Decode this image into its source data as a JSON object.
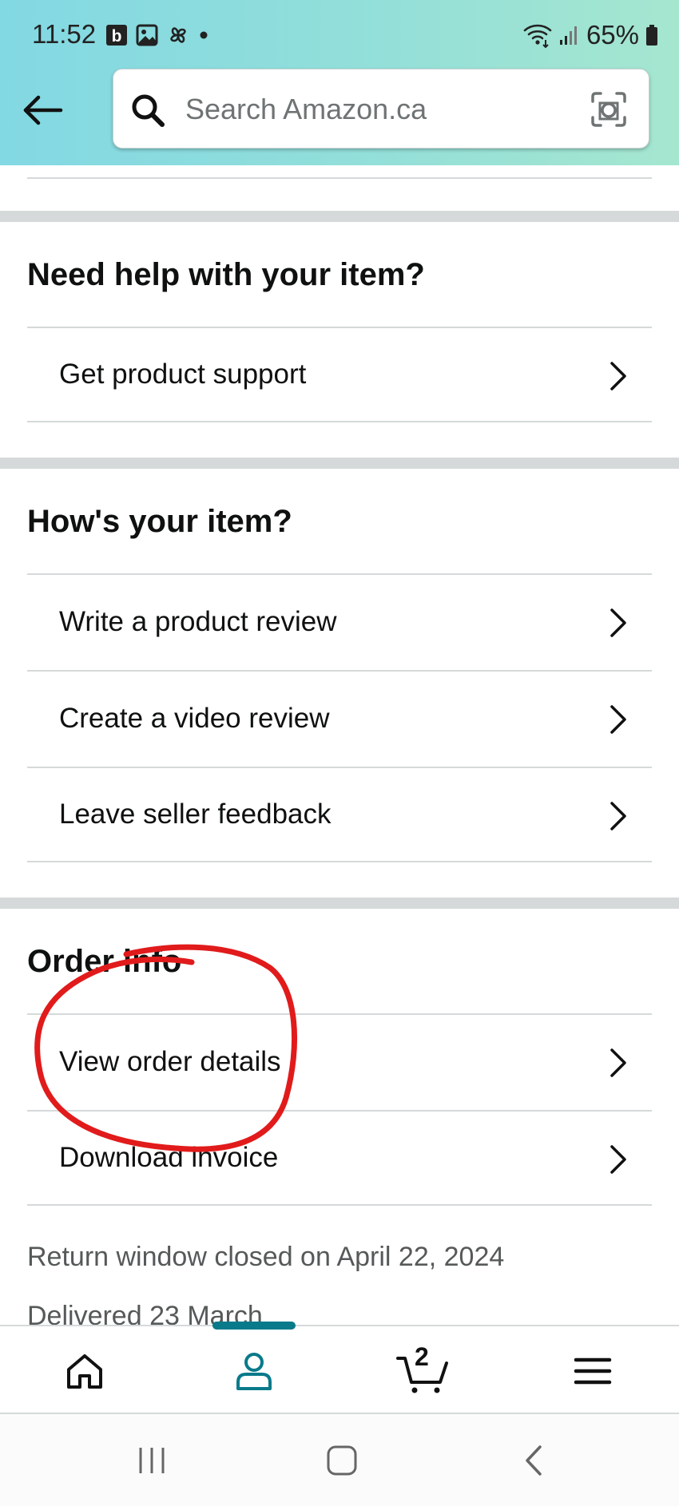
{
  "status_bar": {
    "time": "11:52",
    "battery": "65%"
  },
  "search": {
    "placeholder": "Search Amazon.ca"
  },
  "sections": {
    "help": {
      "title": "Need help with your item?",
      "items": [
        {
          "label": "Get product support"
        }
      ]
    },
    "review": {
      "title": "How's your item?",
      "items": [
        {
          "label": "Write a product review"
        },
        {
          "label": "Create a video review"
        },
        {
          "label": "Leave seller feedback"
        }
      ]
    },
    "order_info": {
      "title": "Order info",
      "items": [
        {
          "label": "View order details"
        },
        {
          "label": "Download invoice"
        }
      ]
    }
  },
  "return_window": "Return window closed on April 22, 2024",
  "delivered": "Delivered 23 March",
  "bottom_nav": {
    "items": [
      "home-icon",
      "account-icon",
      "cart-icon",
      "menu-icon"
    ],
    "cart_count": "2",
    "active_color": "#087a8a"
  },
  "colors": {
    "annotation": "#e11b1b",
    "header_gradient_start": "#82d8e3",
    "header_gradient_end": "#a5e6cf"
  }
}
